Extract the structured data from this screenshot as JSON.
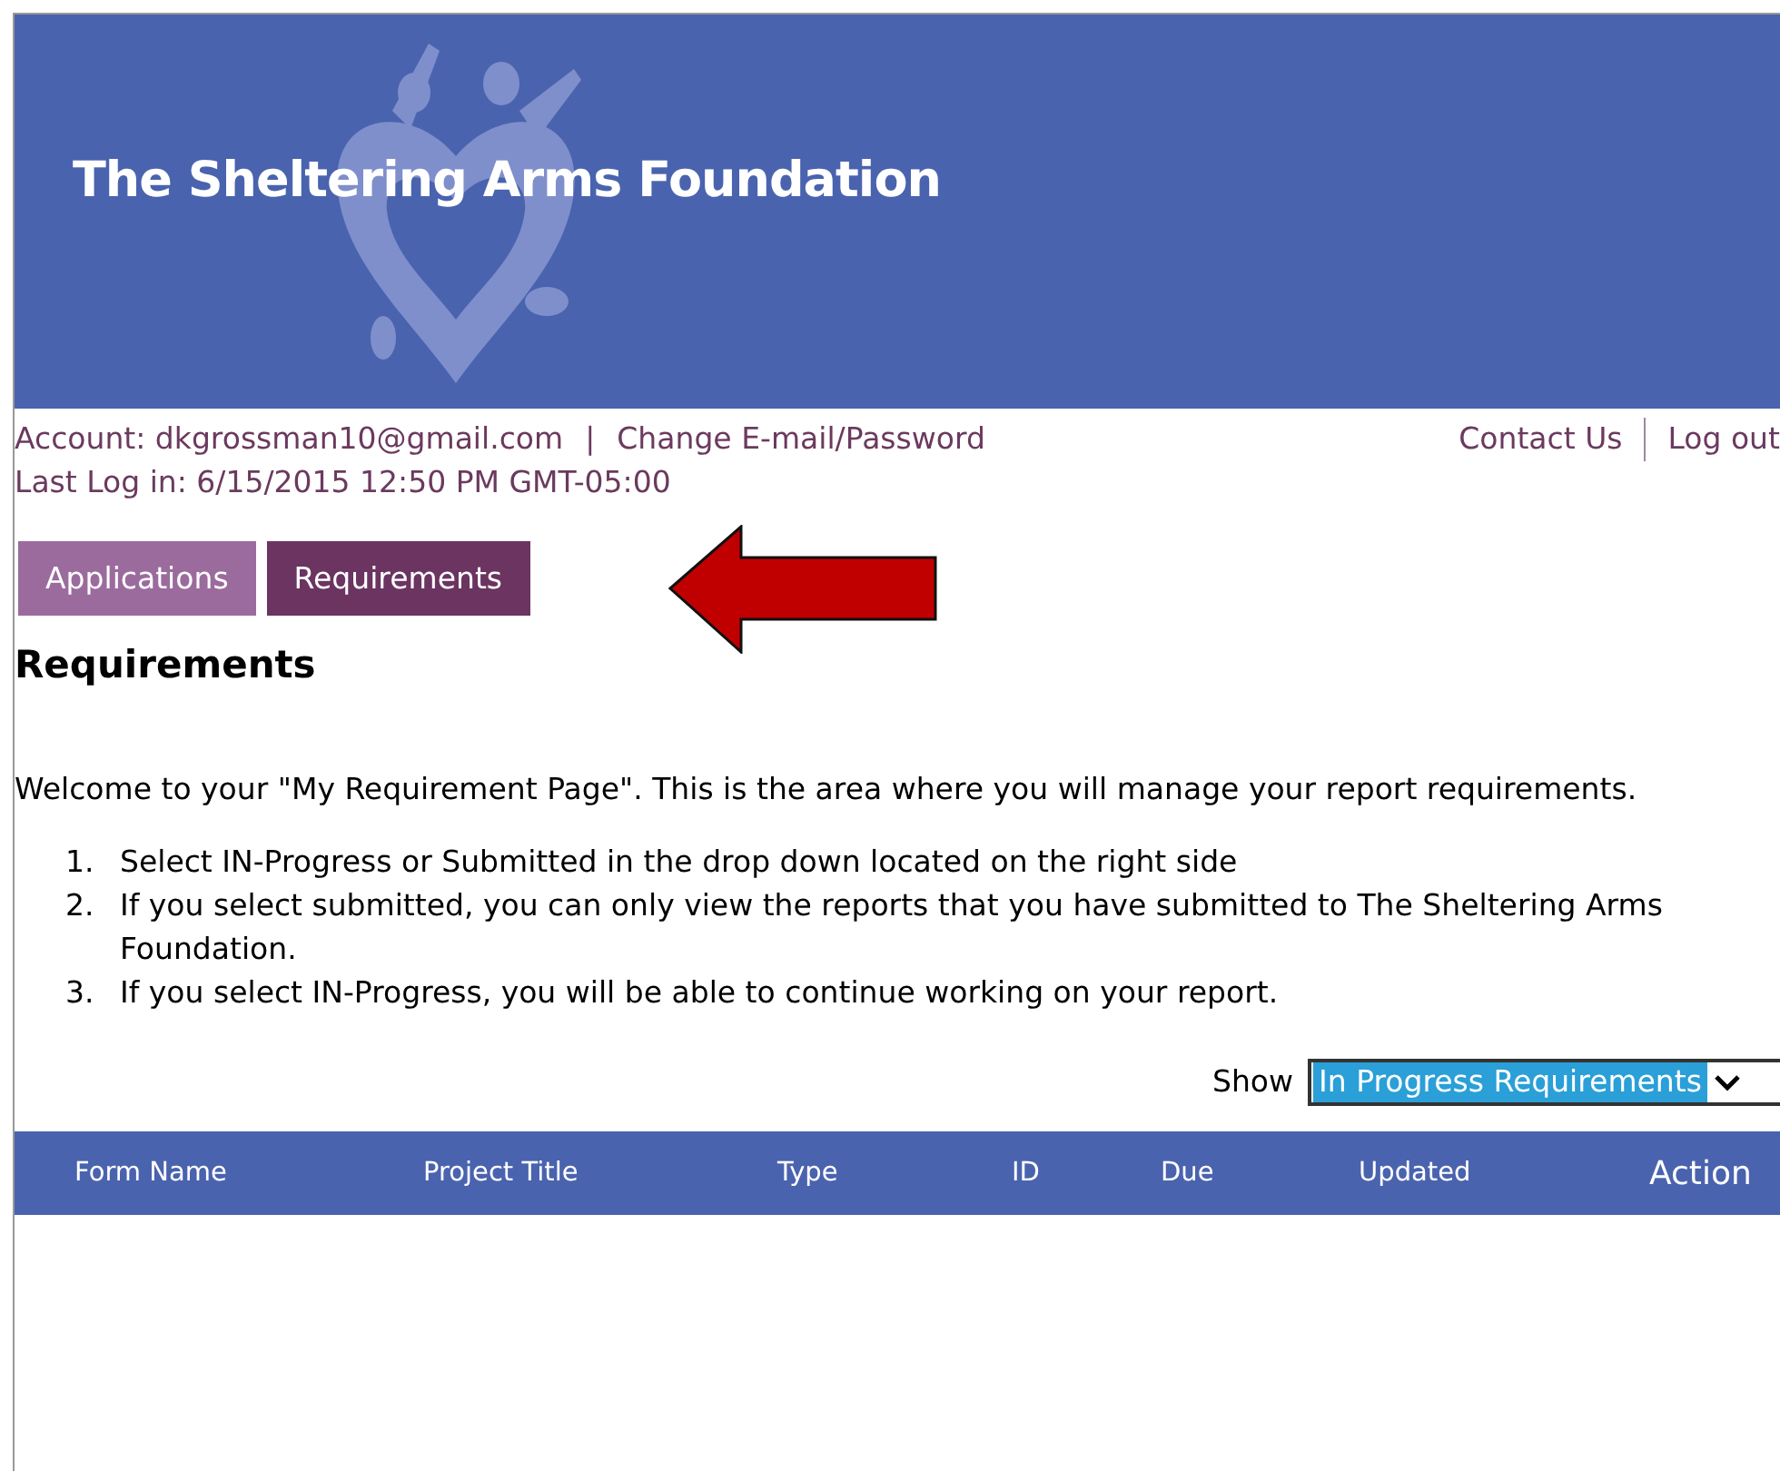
{
  "header": {
    "title": "The Sheltering Arms Foundation"
  },
  "account": {
    "label": "Account: dkgrossman10@gmail.com",
    "separator": "|",
    "change_link": "Change E-mail/Password",
    "last_login": "Last Log in: 6/15/2015 12:50 PM GMT-05:00"
  },
  "top_links": [
    {
      "label": "Contact Us"
    },
    {
      "label": "Log out"
    }
  ],
  "tabs": [
    {
      "label": "Applications",
      "selected": false
    },
    {
      "label": "Requirements",
      "selected": true
    }
  ],
  "page_title": "Requirements",
  "intro": "Welcome to your \"My Requirement Page\". This is the area where you will manage your report requirements.",
  "steps": [
    {
      "number": "1.",
      "text": "Select IN-Progress or Submitted in the drop down located on the right side"
    },
    {
      "number": "2.",
      "text": "If you select submitted, you can only view the reports that you have submitted to The Sheltering Arms Foundation."
    },
    {
      "number": "3.",
      "text": "If you select IN-Progress, you will be able to continue working on your report."
    }
  ],
  "filter": {
    "label": "Show",
    "value": "In Progress Requirements"
  },
  "table": {
    "columns": [
      "Form Name",
      "Project Title",
      "Type",
      "ID",
      "Due",
      "Updated",
      "Action"
    ]
  }
}
